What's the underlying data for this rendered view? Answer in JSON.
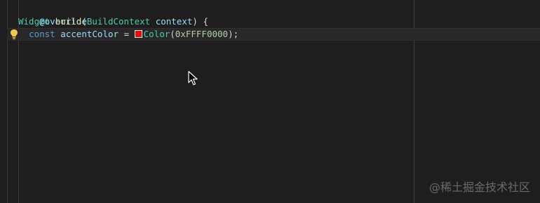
{
  "editor": {
    "lines": [
      {
        "annotation": "@override"
      },
      {
        "type": "Widget",
        "method": "build",
        "open_paren": "(",
        "param_type": "BuildContext",
        "param_name": "context",
        "close": ") {"
      },
      {
        "keyword": "const",
        "var_name": "accentColor",
        "equals": "=",
        "color_class": "Color",
        "open_paren": "(",
        "color_value": "0xFFFF0000",
        "close": ");"
      }
    ],
    "color_swatch": "#ff0000",
    "lightbulb_icon": "lightbulb-icon",
    "pointer_icon": "mouse-pointer-icon"
  },
  "watermark": "@稀土掘金技术社区"
}
